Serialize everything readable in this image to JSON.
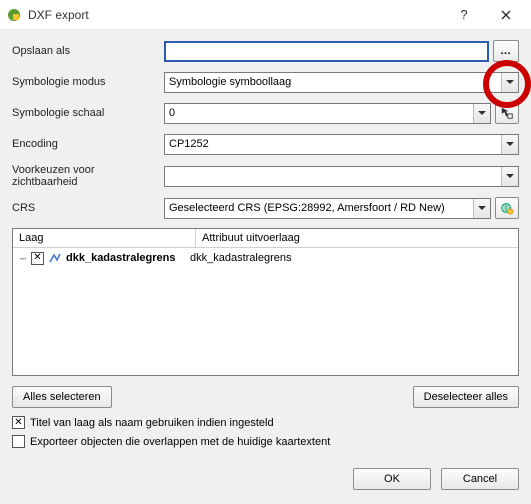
{
  "window": {
    "title": "DXF export",
    "help": "?",
    "close": "×"
  },
  "form": {
    "save_as_label": "Opslaan als",
    "save_as_value": "",
    "browse_label": "…",
    "sym_mode_label": "Symbologie modus",
    "sym_mode_value": "Symbologie symboollaag",
    "sym_scale_label": "Symbologie schaal",
    "sym_scale_value": "0",
    "encoding_label": "Encoding",
    "encoding_value": "CP1252",
    "visibility_presets_label": "Voorkeuzen voor zichtbaarheid",
    "visibility_presets_value": "",
    "crs_label": "CRS",
    "crs_value": "Geselecteerd CRS (EPSG:28992, Amersfoort / RD New)"
  },
  "tree": {
    "header_layer": "Laag",
    "header_attr": "Attribuut uitvoerlaag",
    "rows": [
      {
        "checked": true,
        "name": "dkk_kadastralegrens",
        "attr": "dkk_kadastralegrens"
      }
    ]
  },
  "buttons": {
    "select_all": "Alles selecteren",
    "deselect_all": "Deselecteer alles",
    "ok": "OK",
    "cancel": "Cancel"
  },
  "checks": {
    "use_layer_title": {
      "checked": true,
      "label": "Titel van laag als naam gebruiken indien ingesteld"
    },
    "export_in_extent": {
      "checked": false,
      "label": "Exporteer objecten die overlappen met de huidige kaartextent"
    }
  }
}
